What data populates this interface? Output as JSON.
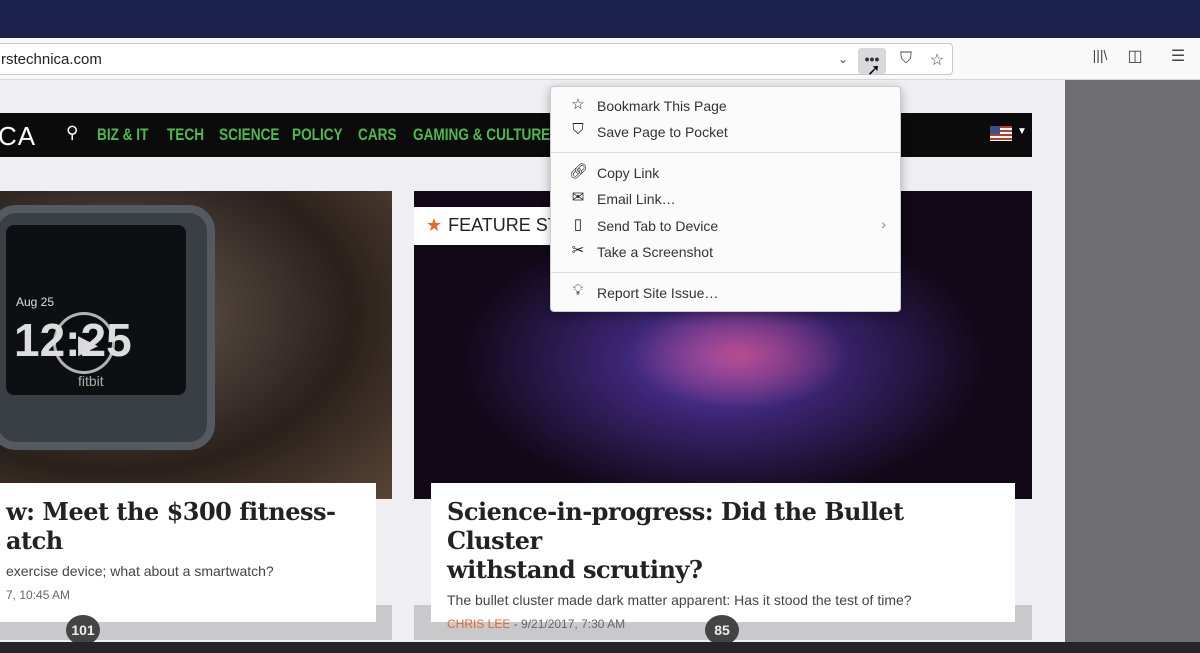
{
  "browser": {
    "url": "arstechnica.com",
    "url_visible": "rstechnica.com",
    "page_actions_icon": "ellipsis-icon",
    "pocket_icon": "pocket-icon",
    "bookmark_icon": "star-icon",
    "dropdown_icon": "chevron-down-icon",
    "library_icon": "library-icon",
    "sidebar_icon": "sidebar-icon",
    "menu_icon": "hamburger-icon"
  },
  "site": {
    "logo_fragment": "CA",
    "nav": [
      "BIZ & IT",
      "TECH",
      "SCIENCE",
      "POLICY",
      "CARS",
      "GAMING & CULTURE"
    ],
    "accent": "#4cbb4c"
  },
  "page_actions_menu": {
    "items": [
      {
        "icon": "star-icon",
        "label": "Bookmark This Page"
      },
      {
        "icon": "pocket-icon",
        "label": "Save Page to Pocket"
      },
      {
        "icon": "link-icon",
        "label": "Copy Link"
      },
      {
        "icon": "email-icon",
        "label": "Email Link…"
      },
      {
        "icon": "device-icon",
        "label": "Send Tab to Device",
        "submenu": true
      },
      {
        "icon": "screenshot-icon",
        "label": "Take a Screenshot"
      },
      {
        "icon": "lightbulb-icon",
        "label": "Report Site Issue…"
      }
    ]
  },
  "articles": [
    {
      "title": "w: Meet the $300 fitness-atch",
      "title_line1": "w: Meet the $300 fitness-",
      "title_line2": "atch",
      "desc": "exercise device; what about a smartwatch?",
      "meta": "7, 10:45 AM",
      "comments": "101",
      "watch_date": "Aug 25",
      "watch_time": "12:25",
      "watch_brand": "fitbit"
    },
    {
      "badge": "FEATURE STO",
      "title_line1": "Science-in-progress: Did the Bullet Cluster",
      "title_line2": "withstand scrutiny?",
      "desc": "The bullet cluster made dark matter apparent: Has it stood the test of time?",
      "author": "CHRIS LEE",
      "meta": " - 9/21/2017, 7:30 AM",
      "comments": "85"
    }
  ]
}
